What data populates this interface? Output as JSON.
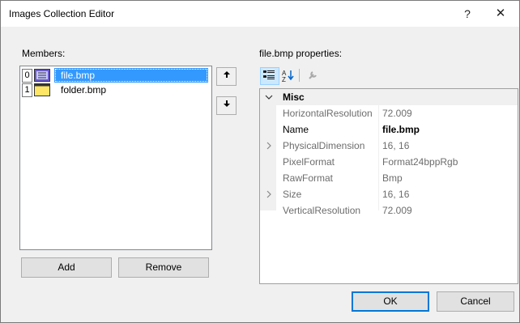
{
  "window": {
    "title": "Images Collection Editor",
    "help_glyph": "?",
    "close_glyph": "✕"
  },
  "members": {
    "label": "Members:",
    "items": [
      {
        "index": "0",
        "name": "file.bmp",
        "icon": "file-bitmap-icon",
        "selected": true
      },
      {
        "index": "1",
        "name": "folder.bmp",
        "icon": "folder-icon",
        "selected": false
      }
    ],
    "up_glyph": "🡅",
    "down_glyph": "🡇",
    "add_label": "Add",
    "remove_label": "Remove"
  },
  "properties": {
    "label": "file.bmp properties:",
    "toolbar": [
      "categorized-icon",
      "alphabetical-icon",
      "property-pages-icon"
    ],
    "category": "Misc",
    "rows": [
      {
        "name": "HorizontalResolution",
        "value": "72.009",
        "expandable": false
      },
      {
        "name": "Name",
        "value": "file.bmp",
        "expandable": false,
        "editable": true
      },
      {
        "name": "PhysicalDimension",
        "value": "16, 16",
        "expandable": true
      },
      {
        "name": "PixelFormat",
        "value": "Format24bppRgb",
        "expandable": false
      },
      {
        "name": "RawFormat",
        "value": "Bmp",
        "expandable": false
      },
      {
        "name": "Size",
        "value": "16, 16",
        "expandable": true
      },
      {
        "name": "VerticalResolution",
        "value": "72.009",
        "expandable": false
      }
    ]
  },
  "footer": {
    "ok_label": "OK",
    "cancel_label": "Cancel"
  },
  "colors": {
    "selection": "#3399ff",
    "accent": "#0078d7"
  }
}
